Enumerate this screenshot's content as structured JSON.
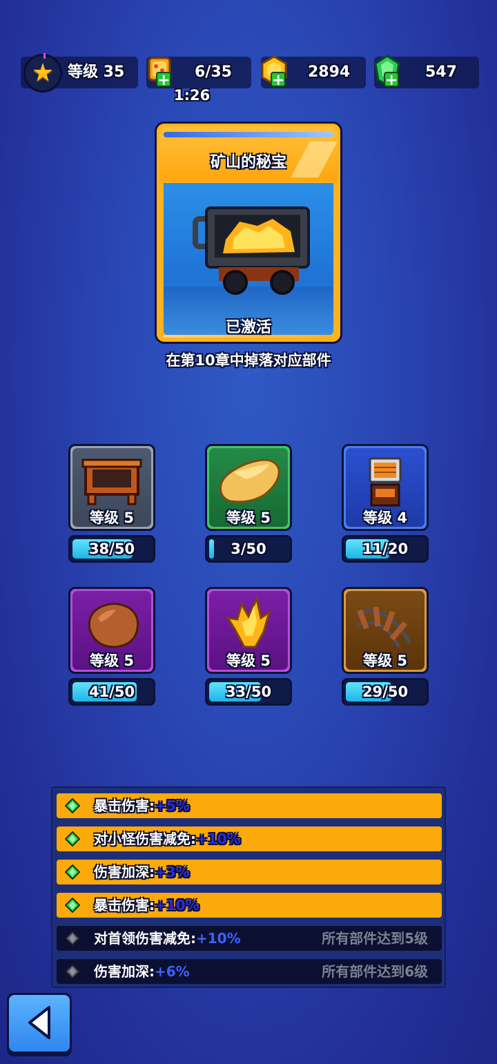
{
  "topbar": {
    "level_label": "等级 35",
    "energy": "6/35",
    "energy_timer": "1:26",
    "gold": "2894",
    "gems": "547",
    "icons": [
      "star-icon",
      "energy-ticket-icon",
      "gold-coin-icon",
      "green-gem-icon",
      "plus-icon"
    ]
  },
  "set_card": {
    "title": "矿山的秘宝",
    "status": "已激活",
    "drop_note": "在第10章中掉落对应部件",
    "icon": "mine-cart-gold-icon"
  },
  "parts": [
    {
      "icon": "wooden-frame-icon",
      "level": "等级 5",
      "progress_text": "38/50",
      "progress": 0.76,
      "rarity_color": "#9aa3b4"
    },
    {
      "icon": "ore-sack-icon",
      "level": "等级 5",
      "progress_text": "3/50",
      "progress": 0.06,
      "rarity_color": "#45c266"
    },
    {
      "icon": "wooden-crate-icon",
      "level": "等级 4",
      "progress_text": "11/20",
      "progress": 0.55,
      "rarity_color": "#4a7cf0"
    },
    {
      "icon": "copper-ore-icon",
      "level": "等级 5",
      "progress_text": "41/50",
      "progress": 0.82,
      "rarity_color": "#b14fd8"
    },
    {
      "icon": "gold-crystal-icon",
      "level": "等级 5",
      "progress_text": "33/50",
      "progress": 0.66,
      "rarity_color": "#b14fd8"
    },
    {
      "icon": "rail-track-icon",
      "level": "等级 5",
      "progress_text": "29/50",
      "progress": 0.58,
      "rarity_color": "#d99a3a"
    }
  ],
  "bonuses": [
    {
      "name": "暴击伤害:",
      "value": "+5%",
      "requirement": "",
      "active": true
    },
    {
      "name": "对小怪伤害减免:",
      "value": "+10%",
      "requirement": "",
      "active": true
    },
    {
      "name": "伤害加深:",
      "value": "+3%",
      "requirement": "",
      "active": true
    },
    {
      "name": "暴击伤害:",
      "value": "+10%",
      "requirement": "",
      "active": true
    },
    {
      "name": "对首领伤害减免:",
      "value": "+10%",
      "requirement": "所有部件达到5级",
      "active": false
    },
    {
      "name": "伤害加深:",
      "value": "+6%",
      "requirement": "所有部件达到6级",
      "active": false
    }
  ],
  "back_button": {
    "icon": "back-arrow-icon"
  }
}
